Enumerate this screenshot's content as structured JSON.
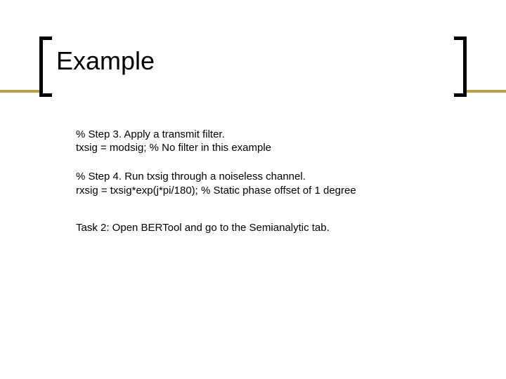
{
  "title": "Example",
  "blocks": [
    {
      "lines": [
        "% Step 3. Apply a transmit filter.",
        "txsig = modsig; % No filter in this example"
      ]
    },
    {
      "lines": [
        "% Step 4. Run txsig through a noiseless channel.",
        "rxsig = txsig*exp(j*pi/180); % Static phase offset of 1 degree"
      ]
    },
    {
      "lines": [
        "Task 2: Open BERTool and go to the Semianalytic tab."
      ]
    }
  ]
}
